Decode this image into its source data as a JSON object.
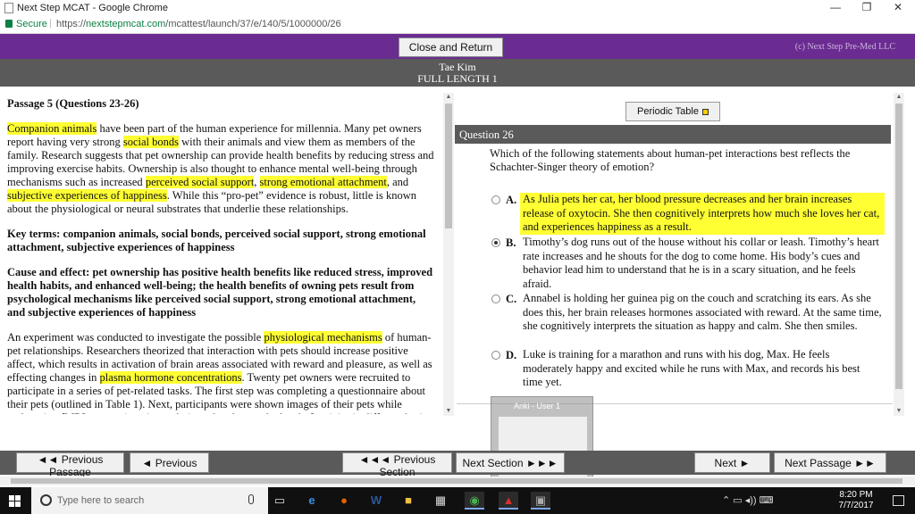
{
  "window": {
    "title": "Next Step MCAT - Google Chrome",
    "minimize": "—",
    "restore": "❐",
    "close": "✕"
  },
  "address": {
    "secure_label": "Secure",
    "separator": "|",
    "url_scheme": "https://",
    "url_host": "nextstepmcat.com",
    "url_path": "/mcattest/launch/37/e/140/5/1000000/26"
  },
  "header": {
    "close_return": "Close and Return",
    "copyright": "(c) Next Step Pre-Med LLC",
    "student": "Tae Kim",
    "exam": "FULL LENGTH 1"
  },
  "passage": {
    "title": "Passage 5 (Questions 23-26)",
    "p1": [
      {
        "t": "Companion animals",
        "hl": true
      },
      {
        "t": " have been part of the human experience for millennia. Many pet owners report having very strong "
      },
      {
        "t": "social bonds",
        "hl": true
      },
      {
        "t": " with their animals and view them as members of the family. Research suggests that pet ownership can provide health benefits by reducing stress and improving exercise habits. Ownership is also thought to enhance mental well-being through mechanisms such as increased "
      },
      {
        "t": "perceived social support",
        "hl": true
      },
      {
        "t": ", "
      },
      {
        "t": "strong emotional attachment",
        "hl": true
      },
      {
        "t": ", and "
      },
      {
        "t": "subjective experiences of happiness",
        "hl": true
      },
      {
        "t": ". While this “pro-pet” evidence is robust, little is known about the physiological or neural substrates that underlie these relationships."
      }
    ],
    "key_terms": "Key terms: companion animals, social bonds, perceived social support, strong emotional attachment, subjective experiences of happiness",
    "cause_effect": "Cause and effect: pet ownership has positive health benefits like reduced stress, improved health habits, and enhanced well-being; the health benefits of owning pets result from psychological mechanisms like perceived social support, strong emotional attachment, and subjective experiences of happiness",
    "p2": [
      {
        "t": "An experiment was conducted to investigate the possible "
      },
      {
        "t": "physiological mechanisms",
        "hl": true
      },
      {
        "t": " of human-pet relationships. Researchers theorized that interaction with pets should increase positive affect, which results in activation of brain areas associated with reward and pleasure, as well as effecting changes in "
      },
      {
        "t": "plasma hormone concentrations",
        "hl": true
      },
      {
        "t": ". Twenty pet owners were recruited to participate in a series of pet-related tasks. The first step was completing a questionnaire about their pets (outlined in Table 1). Next, participants were shown images of their pets while undergoing fMRI, a neuroimaging technique that detects the level of activity in different brain regions."
      }
    ]
  },
  "question": {
    "periodic_table": "Periodic Table",
    "header": "Question 26",
    "stem": "Which of the following statements about human-pet interactions best reflects the Schachter-Singer theory of emotion?",
    "choices": [
      {
        "letter": "A.",
        "text": "As Julia pets her cat, her blood pressure decreases and her brain increases release of oxytocin. She then cognitively interprets how much she loves her cat, and experiences happiness as a result."
      },
      {
        "letter": "B.",
        "text": "Timothy’s dog runs out of the house without his collar or leash. Timothy’s heart rate increases and he shouts for the dog to come home. His body’s cues and behavior lead him to understand that he is in a scary situation, and he feels afraid."
      },
      {
        "letter": "C.",
        "text": "Annabel is holding her guinea pig on the couch and scratching its ears. As she does this, her brain releases hormones associated with reward. At the same time, she cognitively interprets the situation as happy and calm. She then smiles."
      },
      {
        "letter": "D.",
        "text": "Luke is training for a marathon and runs with his dog, Max. He feels moderately happy and excited while he runs with Max, and records his best time yet."
      }
    ],
    "selected": "B",
    "highlighted": "A"
  },
  "anki": {
    "title": "Anki - User 1"
  },
  "nav": {
    "prev_passage": "◄◄ Previous Passage",
    "previous": "◄ Previous",
    "prev_section": "◄◄◄ Previous Section",
    "next_section": "Next Section ►►►",
    "next": "Next ►",
    "next_passage": "Next Passage ►►"
  },
  "taskbar": {
    "search_placeholder": "Type here to search",
    "time": "8:20 PM",
    "date": "7/7/2017"
  },
  "colors": {
    "purple_bar": "#6b2c91",
    "gray_bar": "#5a5a5a",
    "highlight": "#ffff33"
  }
}
